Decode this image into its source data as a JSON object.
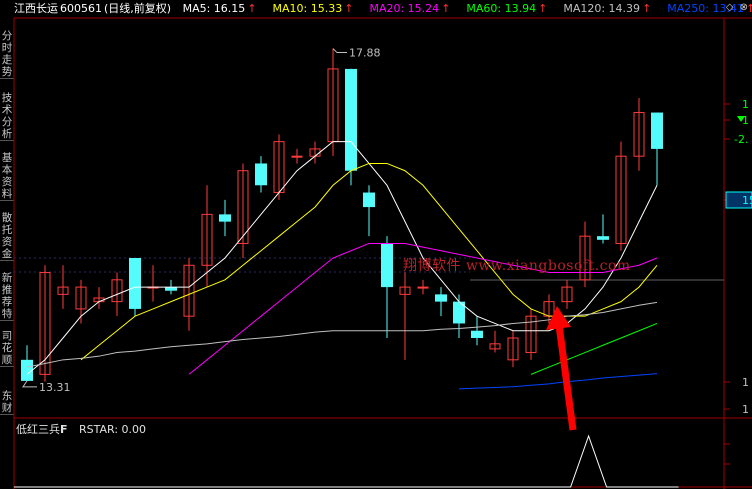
{
  "header": {
    "stock": "江西长运",
    "code": "600561",
    "period": "(日线,前复权)",
    "ma": [
      {
        "label": "MA5: 16.15",
        "color": "#ffffff"
      },
      {
        "label": "MA10: 15.33",
        "color": "#ffff00"
      },
      {
        "label": "MA20: 15.24",
        "color": "#ff00ff"
      },
      {
        "label": "MA60: 13.94",
        "color": "#00ff00"
      },
      {
        "label": "MA120: 14.39",
        "color": "#c0c0c0"
      },
      {
        "label": "MA250: 13.41",
        "color": "#0044ff"
      }
    ],
    "arrow": "↑",
    "icons": [
      "◇",
      "⊗"
    ]
  },
  "sidebar": {
    "tabs": [
      "分时走势",
      "技术分析",
      "基本资料",
      "散托资金",
      "新推荐特",
      "司花顺",
      "东财"
    ]
  },
  "watermark": "翔博软件 www.xiangbosoft.com",
  "indicator": {
    "name": "低红三兵",
    "flag": "F",
    "value": "RSTAR: 0.00"
  },
  "right_axis": {
    "labels": [
      "1",
      "1",
      "-2.",
      "15.6",
      "1",
      "1"
    ]
  },
  "chart_data": {
    "type": "candlestick",
    "title": "",
    "xlabel": "",
    "ylabel": "",
    "ylim": [
      12.8,
      18.3
    ],
    "annotations": {
      "high": "17.88",
      "low": "13.31"
    },
    "candles": [
      {
        "o": 13.6,
        "c": 13.31,
        "h": 13.8,
        "l": 13.31
      },
      {
        "o": 13.4,
        "c": 14.8,
        "h": 14.9,
        "l": 13.3
      },
      {
        "o": 14.5,
        "c": 14.6,
        "h": 14.9,
        "l": 14.3
      },
      {
        "o": 14.3,
        "c": 14.6,
        "h": 14.7,
        "l": 14.1
      },
      {
        "o": 14.4,
        "c": 14.45,
        "h": 14.6,
        "l": 14.3
      },
      {
        "o": 14.4,
        "c": 14.7,
        "h": 14.8,
        "l": 14.2
      },
      {
        "o": 15.0,
        "c": 14.3,
        "h": 15.0,
        "l": 14.2
      },
      {
        "o": 14.6,
        "c": 14.6,
        "h": 14.9,
        "l": 14.4
      },
      {
        "o": 14.6,
        "c": 14.55,
        "h": 14.7,
        "l": 14.5
      },
      {
        "o": 14.2,
        "c": 14.9,
        "h": 15.0,
        "l": 14.0
      },
      {
        "o": 14.9,
        "c": 15.6,
        "h": 16.0,
        "l": 14.6
      },
      {
        "o": 15.6,
        "c": 15.5,
        "h": 15.8,
        "l": 15.3
      },
      {
        "o": 15.2,
        "c": 16.2,
        "h": 16.3,
        "l": 15.0
      },
      {
        "o": 16.3,
        "c": 16.0,
        "h": 16.4,
        "l": 15.9
      },
      {
        "o": 15.9,
        "c": 16.6,
        "h": 16.7,
        "l": 15.8
      },
      {
        "o": 16.4,
        "c": 16.4,
        "h": 16.5,
        "l": 16.3
      },
      {
        "o": 16.4,
        "c": 16.5,
        "h": 16.6,
        "l": 16.3
      },
      {
        "o": 16.6,
        "c": 17.6,
        "h": 17.88,
        "l": 16.4
      },
      {
        "o": 17.6,
        "c": 16.2,
        "h": 17.6,
        "l": 16.0
      },
      {
        "o": 15.9,
        "c": 15.7,
        "h": 16.0,
        "l": 15.3
      },
      {
        "o": 15.2,
        "c": 14.6,
        "h": 15.3,
        "l": 13.9
      },
      {
        "o": 14.5,
        "c": 14.6,
        "h": 14.8,
        "l": 13.6
      },
      {
        "o": 14.6,
        "c": 14.6,
        "h": 14.7,
        "l": 14.5
      },
      {
        "o": 14.5,
        "c": 14.4,
        "h": 14.6,
        "l": 14.2
      },
      {
        "o": 14.4,
        "c": 14.1,
        "h": 14.5,
        "l": 13.9
      },
      {
        "o": 14.0,
        "c": 13.9,
        "h": 14.2,
        "l": 13.8
      },
      {
        "o": 13.75,
        "c": 13.82,
        "h": 14.0,
        "l": 13.7
      },
      {
        "o": 13.6,
        "c": 13.9,
        "h": 14.0,
        "l": 13.5
      },
      {
        "o": 13.7,
        "c": 14.2,
        "h": 14.3,
        "l": 13.6
      },
      {
        "o": 14.2,
        "c": 14.4,
        "h": 14.5,
        "l": 14.1
      },
      {
        "o": 14.4,
        "c": 14.6,
        "h": 14.7,
        "l": 14.3
      },
      {
        "o": 14.7,
        "c": 15.3,
        "h": 15.5,
        "l": 14.6
      },
      {
        "o": 15.3,
        "c": 15.25,
        "h": 15.6,
        "l": 15.2
      },
      {
        "o": 15.2,
        "c": 16.4,
        "h": 16.6,
        "l": 15.1
      },
      {
        "o": 16.4,
        "c": 17.0,
        "h": 17.2,
        "l": 16.2
      },
      {
        "o": 17.0,
        "c": 16.5,
        "h": 17.0,
        "l": 16.0
      }
    ],
    "series": [
      {
        "name": "MA5",
        "values": [
          13.4,
          13.6,
          13.9,
          14.2,
          14.4,
          14.5,
          14.6,
          14.6,
          14.6,
          14.6,
          14.8,
          15.0,
          15.3,
          15.6,
          15.9,
          16.2,
          16.4,
          16.6,
          16.6,
          16.3,
          16.0,
          15.5,
          15.0,
          14.7,
          14.4,
          14.2,
          14.1,
          14.0,
          14.0,
          14.0,
          14.1,
          14.3,
          14.6,
          15.0,
          15.5,
          16.0
        ]
      },
      {
        "name": "MA10",
        "values": [
          null,
          null,
          null,
          13.6,
          13.8,
          14.0,
          14.2,
          14.3,
          14.4,
          14.5,
          14.6,
          14.7,
          14.9,
          15.1,
          15.3,
          15.5,
          15.7,
          16.0,
          16.2,
          16.3,
          16.3,
          16.2,
          16.0,
          15.7,
          15.4,
          15.1,
          14.8,
          14.5,
          14.3,
          14.2,
          14.2,
          14.2,
          14.3,
          14.4,
          14.6,
          14.9
        ]
      },
      {
        "name": "MA20",
        "values": [
          null,
          null,
          null,
          null,
          null,
          null,
          null,
          null,
          null,
          13.4,
          13.6,
          13.8,
          14.0,
          14.2,
          14.4,
          14.6,
          14.8,
          15.0,
          15.1,
          15.2,
          15.2,
          15.2,
          15.15,
          15.1,
          15.05,
          15.0,
          14.95,
          14.9,
          14.85,
          14.8,
          14.8,
          14.8,
          14.8,
          14.85,
          14.9,
          15.0
        ]
      },
      {
        "name": "MA60",
        "values": [
          null,
          null,
          null,
          null,
          null,
          null,
          null,
          null,
          null,
          null,
          null,
          null,
          null,
          null,
          null,
          null,
          null,
          null,
          null,
          null,
          null,
          null,
          null,
          null,
          null,
          null,
          null,
          null,
          13.4,
          13.5,
          13.6,
          13.7,
          13.8,
          13.9,
          14.0,
          14.1
        ]
      },
      {
        "name": "MA120",
        "values": [
          13.5,
          13.55,
          13.6,
          13.62,
          13.65,
          13.7,
          13.72,
          13.75,
          13.78,
          13.8,
          13.82,
          13.85,
          13.88,
          13.9,
          13.92,
          13.95,
          13.98,
          14.0,
          14.0,
          14.0,
          14.0,
          14.0,
          14.0,
          14.02,
          14.03,
          14.05,
          14.07,
          14.1,
          14.12,
          14.15,
          14.2,
          14.22,
          14.25,
          14.3,
          14.35,
          14.39
        ]
      },
      {
        "name": "MA250",
        "values": [
          null,
          null,
          null,
          null,
          null,
          null,
          null,
          null,
          null,
          null,
          null,
          null,
          null,
          null,
          null,
          null,
          null,
          null,
          null,
          null,
          null,
          null,
          null,
          null,
          13.2,
          13.21,
          13.22,
          13.23,
          13.25,
          13.27,
          13.3,
          13.32,
          13.35,
          13.37,
          13.39,
          13.41
        ]
      }
    ],
    "rstar": [
      0,
      0,
      0,
      0,
      0,
      0,
      0,
      0,
      0,
      0,
      0,
      0,
      0,
      0,
      0,
      0,
      0,
      0,
      0,
      0,
      0,
      0,
      0,
      0,
      0,
      0,
      0,
      0,
      0,
      0,
      1,
      0,
      0,
      0,
      0,
      0
    ]
  }
}
